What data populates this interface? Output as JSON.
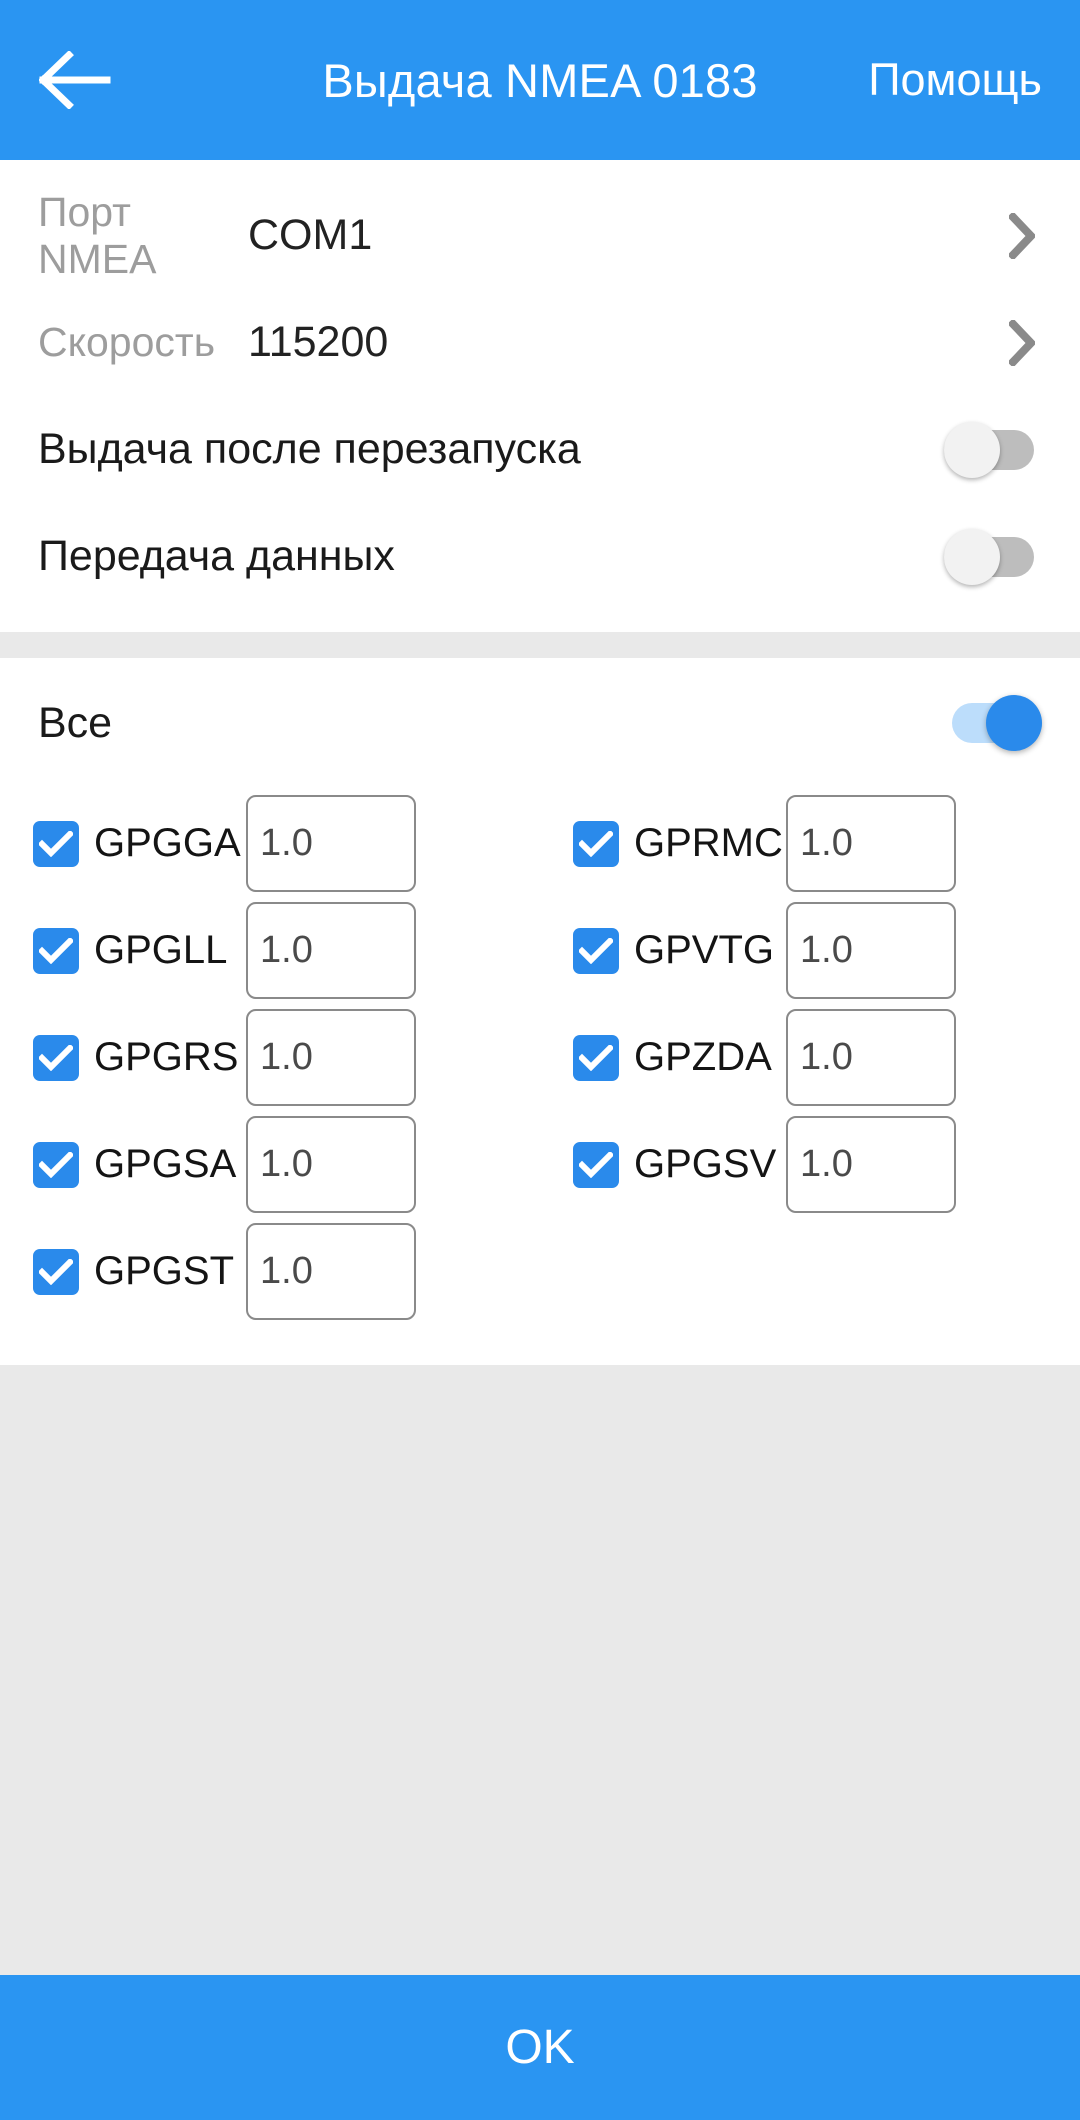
{
  "colors": {
    "accent": "#2a95f2",
    "toggle_on_knob": "#2a8aeb",
    "toggle_on_track": "#bcddfb",
    "toggle_off_track": "#bdbdbd",
    "checkbox_fill": "#2a8aeb",
    "page_background": "#e9e9e9",
    "card_background": "#ffffff",
    "muted_label": "#9d9d9d"
  },
  "header": {
    "back_icon": "arrow-left-icon",
    "title": "Выдача NMEA 0183",
    "help_label": "Помощь"
  },
  "settings": {
    "rows": [
      {
        "label": "Порт NMEA",
        "value": "COM1",
        "chevron": "chevron-right-icon"
      },
      {
        "label": "Скорость",
        "value": "115200",
        "chevron": "chevron-right-icon"
      }
    ],
    "toggles": [
      {
        "label": "Выдача после перезапуска",
        "state": "off"
      },
      {
        "label": "Передача данных",
        "state": "off"
      }
    ]
  },
  "sentences": {
    "all_label": "Все",
    "all_state": "on",
    "rows": [
      {
        "left": {
          "name": "GPGGA",
          "checked": true,
          "rate": "1.0"
        },
        "right": {
          "name": "GPRMC",
          "checked": true,
          "rate": "1.0"
        }
      },
      {
        "left": {
          "name": "GPGLL",
          "checked": true,
          "rate": "1.0"
        },
        "right": {
          "name": "GPVTG",
          "checked": true,
          "rate": "1.0"
        }
      },
      {
        "left": {
          "name": "GPGRS",
          "checked": true,
          "rate": "1.0"
        },
        "right": {
          "name": "GPZDA",
          "checked": true,
          "rate": "1.0"
        }
      },
      {
        "left": {
          "name": "GPGSA",
          "checked": true,
          "rate": "1.0"
        },
        "right": {
          "name": "GPGSV",
          "checked": true,
          "rate": "1.0"
        }
      },
      {
        "left": {
          "name": "GPGST",
          "checked": true,
          "rate": "1.0"
        },
        "right": null
      }
    ]
  },
  "footer": {
    "ok_label": "OK"
  }
}
